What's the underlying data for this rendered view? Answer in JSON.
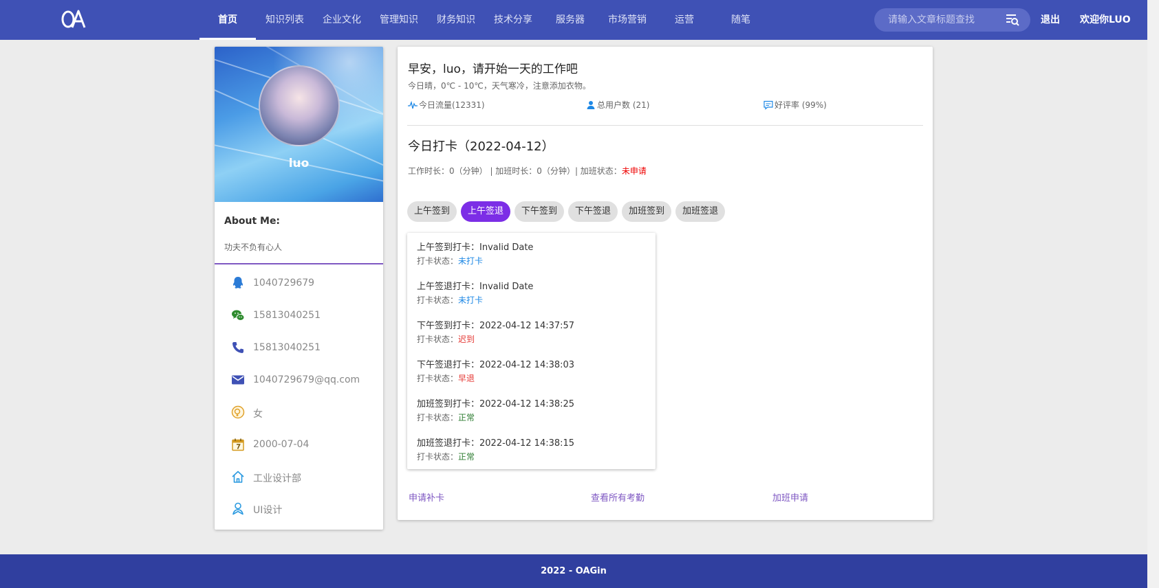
{
  "header": {
    "logo": "OA",
    "nav": [
      {
        "label": "首页",
        "active": true
      },
      {
        "label": "知识列表"
      },
      {
        "label": "企业文化"
      },
      {
        "label": "管理知识"
      },
      {
        "label": "财务知识"
      },
      {
        "label": "技术分享"
      },
      {
        "label": "服务器"
      },
      {
        "label": "市场营销"
      },
      {
        "label": "运营"
      },
      {
        "label": "随笔"
      }
    ],
    "search_placeholder": "请输入文章标题查找",
    "logout": "退出",
    "welcome": "欢迎你LUO"
  },
  "profile": {
    "name": "luo",
    "about_title": "About Me:",
    "about_text": "功夫不负有心人",
    "info": [
      {
        "icon": "qq-icon",
        "value": "1040729679",
        "color": "#2b7bd6"
      },
      {
        "icon": "wechat-icon",
        "value": "15813040251",
        "color": "#2e8b2e"
      },
      {
        "icon": "phone-icon",
        "value": "15813040251",
        "color": "#3f51b5"
      },
      {
        "icon": "mail-icon",
        "value": "1040729679@qq.com",
        "color": "#3f51b5"
      },
      {
        "icon": "gender-icon",
        "value": "女",
        "color": "#e0a12a"
      },
      {
        "icon": "calendar-icon",
        "value": "2000-07-04",
        "color": "#e0a12a"
      },
      {
        "icon": "home-icon",
        "value": "工业设计部",
        "color": "#2b9ae0"
      },
      {
        "icon": "user-icon",
        "value": "UI设计",
        "color": "#2b9ae0"
      }
    ]
  },
  "main": {
    "greeting": "早安，luo，请开始一天的工作吧",
    "weather": "今日晴，0℃ - 10℃，天气寒冷，注意添加衣物。",
    "stats": [
      {
        "icon": "pulse-icon",
        "label": "今日流量(12331)"
      },
      {
        "icon": "users-icon",
        "label": "总用户数 (21)"
      },
      {
        "icon": "comment-icon",
        "label": "好评率 (99%)"
      }
    ],
    "checkin_title": "今日打卡（2022-04-12）",
    "worktime_prefix": "工作时长：0（分钟） | 加班时长：0（分钟）| 加班状态：",
    "overtime_status": "未申请",
    "chips": [
      {
        "label": "上午签到"
      },
      {
        "label": "上午签退",
        "active": true
      },
      {
        "label": "下午签到"
      },
      {
        "label": "下午签退"
      },
      {
        "label": "加班签到"
      },
      {
        "label": "加班签退"
      }
    ],
    "records": [
      {
        "title": "上午签到打卡：Invalid Date",
        "status_label": "打卡状态：",
        "status": "未打卡",
        "status_color": "#1e88e5"
      },
      {
        "title": "上午签退打卡：Invalid Date",
        "status_label": "打卡状态：",
        "status": "未打卡",
        "status_color": "#1e88e5"
      },
      {
        "title": "下午签到打卡：2022-04-12 14:37:57",
        "status_label": "打卡状态：",
        "status": "迟到",
        "status_color": "#e53935"
      },
      {
        "title": "下午签退打卡：2022-04-12 14:38:03",
        "status_label": "打卡状态：",
        "status": "早退",
        "status_color": "#e53935"
      },
      {
        "title": "加班签到打卡：2022-04-12 14:38:25",
        "status_label": "打卡状态：",
        "status": "正常",
        "status_color": "#2e7d32"
      },
      {
        "title": "加班签退打卡：2022-04-12 14:38:15",
        "status_label": "打卡状态：",
        "status": "正常",
        "status_color": "#2e7d32"
      }
    ],
    "links": {
      "makeup": "申请补卡",
      "all_attendance": "查看所有考勤",
      "overtime_apply": "加班申请"
    }
  },
  "footer": {
    "text": "2022 - OAGin"
  }
}
